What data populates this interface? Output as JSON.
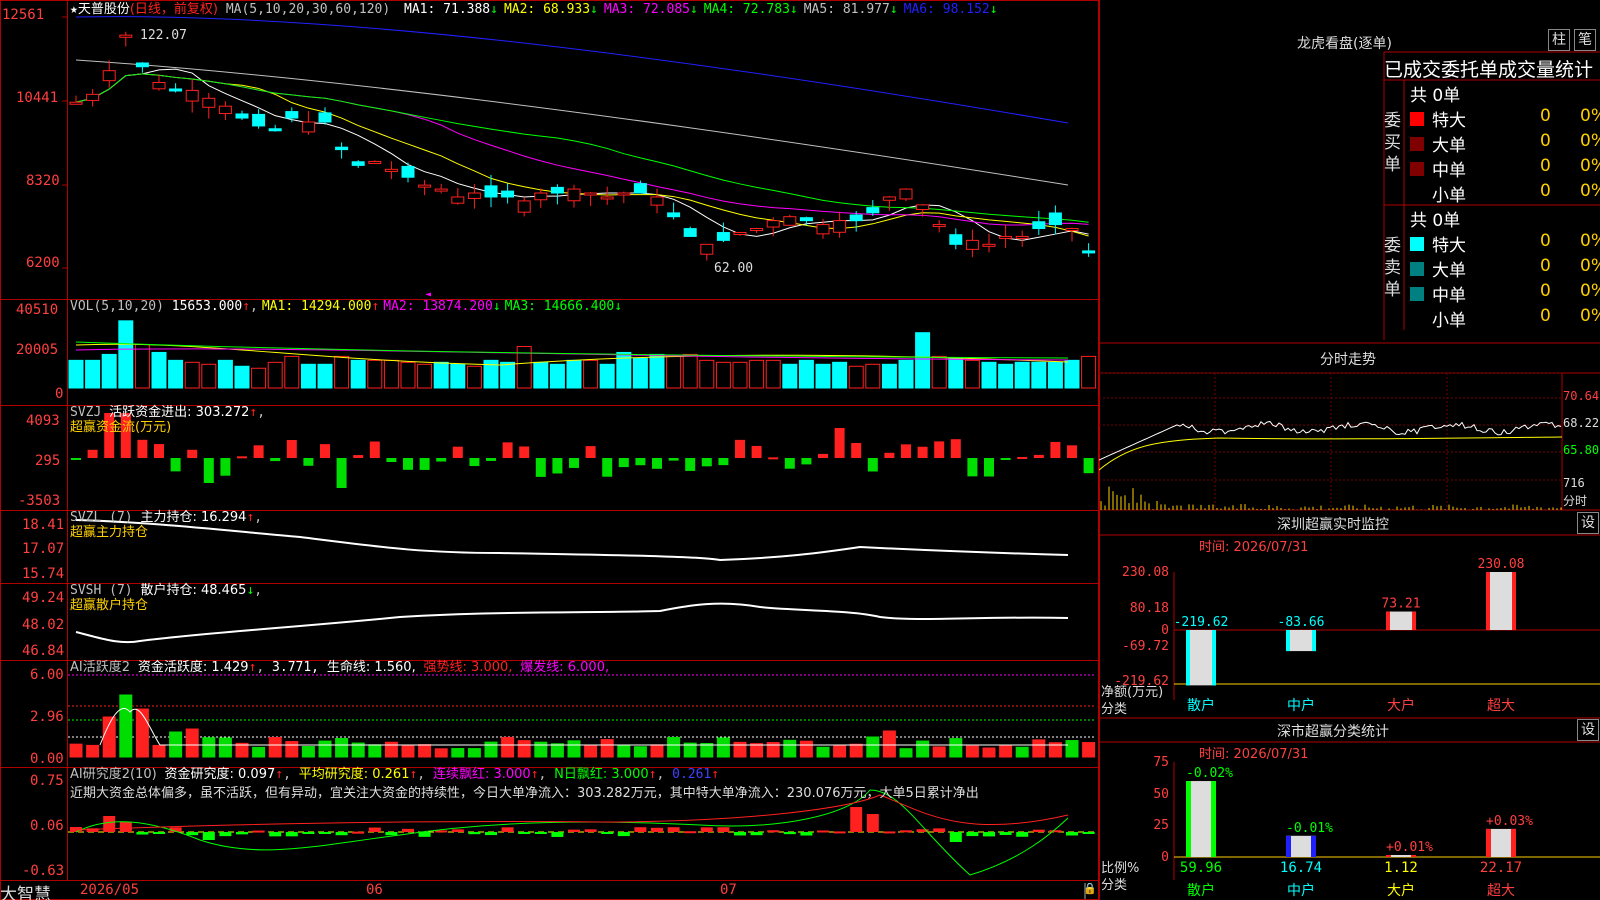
{
  "colors": {
    "up": "#ff2020",
    "down": "#00ffff",
    "ma5": "#ffffff",
    "ma10": "#ffff00",
    "ma20": "#ff00ff",
    "ma30": "#00ff00",
    "ma60": "#c0c0c0",
    "ma120": "#2020ff",
    "grid": "#b00000"
  },
  "main": {
    "stock_name": "天普股份",
    "period": "(日线，前复权)",
    "ma_label": "MA(5,10,20,30,60,120)",
    "ma_values": [
      {
        "label": "MA1: 71.388",
        "arrow": "↓"
      },
      {
        "label": "MA2: 68.933",
        "arrow": "↓"
      },
      {
        "label": "MA3: 72.085",
        "arrow": "↓"
      },
      {
        "label": "MA4: 72.783",
        "arrow": "↓"
      },
      {
        "label": "MA5: 81.977",
        "arrow": "↓"
      },
      {
        "label": "MA6: 98.152",
        "arrow": "↓"
      }
    ],
    "y_labels": [
      "12561",
      "10441",
      "8320",
      "6200"
    ],
    "high_label": "122.07",
    "low_label": "62.00"
  },
  "vol": {
    "title": "VOL(5,10,20)",
    "value": "15653.000",
    "ma": [
      {
        "label": "MA1: 14294.000",
        "arrow": "↑"
      },
      {
        "label": "MA2: 13874.200",
        "arrow": "↓"
      },
      {
        "label": "MA3: 14666.400",
        "arrow": "↓"
      }
    ],
    "y_labels": [
      "40510",
      "20005",
      "0"
    ]
  },
  "svzj": {
    "title": "SVZJ",
    "label": "活跃资金进出: 303.272",
    "arrow": "↑",
    "subtitle": "超赢资金流(万元)",
    "y_labels": [
      "4093",
      "295",
      "-3503"
    ]
  },
  "svzl": {
    "title": "SVZL (7)",
    "label": "主力持仓: 16.294",
    "arrow": "↑",
    "subtitle": "超赢主力持仓",
    "y_labels": [
      "18.41",
      "17.07",
      "15.74"
    ]
  },
  "svsh": {
    "title": "SVSH (7)",
    "label": "散户持仓: 48.465",
    "arrow": "↓",
    "subtitle": "超赢散户持仓",
    "y_labels": [
      "49.24",
      "48.02",
      "46.84"
    ]
  },
  "ai_active": {
    "title": "AI活跃度2",
    "label1": "资金活跃度: 1.429",
    "arrow1": "↑",
    "label2": "3.771,",
    "label3": "生命线: 1.560,",
    "label4": "强势线: 3.000,",
    "label5": "爆发线: 6.000,",
    "y_labels": [
      "6.00",
      "2.96",
      "0.00"
    ]
  },
  "ai_research": {
    "title": "AI研究度2(10)",
    "label1": "资金研究度: 0.097",
    "arrow1": "↑",
    "label2": "平均研究度: 0.261",
    "arrow2": "↑",
    "label3": "连续飘红: 3.000",
    "arrow3": "↑",
    "label4": "N日飘红: 3.000",
    "arrow4": "↑",
    "label5": "0.261",
    "arrow5": "↑",
    "comment": "近期大资金总体偏多，虽不活跃，但有异动，宜关注大资金的持续性，今日大单净流入：303.282万元，其中特大单净流入：230.076万元，大单5日累计净出",
    "y_labels": [
      "0.75",
      "0.06",
      "-0.63"
    ]
  },
  "footer": {
    "brand": "大智慧",
    "dates": [
      "2026/05",
      "06",
      "07"
    ]
  },
  "lhb": {
    "title": "龙虎看盘(逐单)",
    "tab_bar": "柱",
    "tab_pen": "笔",
    "subtitle": "已成交委托单成交量统计",
    "buy_side": "委买单",
    "sell_side": "委卖单",
    "buy": {
      "total": "共 0单",
      "rows": [
        {
          "name": "特大",
          "count": "0",
          "pct": "0%",
          "color": "#ff0000"
        },
        {
          "name": "大单",
          "count": "0",
          "pct": "0%",
          "color": "#800000"
        },
        {
          "name": "中单",
          "count": "0",
          "pct": "0%",
          "color": "#800000"
        },
        {
          "name": "小单",
          "count": "0",
          "pct": "0%",
          "color": ""
        }
      ]
    },
    "sell": {
      "total": "共 0单",
      "rows": [
        {
          "name": "特大",
          "count": "0",
          "pct": "0%",
          "color": "#00ffff"
        },
        {
          "name": "大单",
          "count": "0",
          "pct": "0%",
          "color": "#008080"
        },
        {
          "name": "中单",
          "count": "0",
          "pct": "0%",
          "color": "#008080"
        },
        {
          "name": "小单",
          "count": "0",
          "pct": "0%",
          "color": ""
        }
      ]
    }
  },
  "intraday": {
    "title": "分时走势",
    "y_labels": [
      "70.64",
      "68.22",
      "65.80",
      "716",
      "分时"
    ]
  },
  "sz_monitor": {
    "title": "深圳超赢实时监控",
    "set": "设",
    "time": "时间: 2026/07/31",
    "y_labels": [
      "230.08",
      "80.18",
      "0",
      "-69.72",
      "-219.62"
    ],
    "axis_label": "净额(万元)",
    "axis_label2": "分类",
    "categories": [
      "散户",
      "中户",
      "大户",
      "超大"
    ],
    "values": [
      -219.62,
      -83.66,
      73.21,
      230.08
    ],
    "value_labels": [
      "-219.62",
      "-83.66",
      "73.21",
      "230.08"
    ]
  },
  "sz_class": {
    "title": "深市超赢分类统计",
    "set": "设",
    "time": "时间: 2026/07/31",
    "y_labels": [
      "75",
      "50",
      "25",
      "0"
    ],
    "axis_label": "比例%",
    "axis_label2": "分类",
    "categories": [
      "散户",
      "中户",
      "大户",
      "超大"
    ],
    "values": [
      59.96,
      16.74,
      1.12,
      22.17
    ],
    "value_labels": [
      "59.96",
      "16.74",
      "1.12",
      "22.17"
    ],
    "change_labels": [
      "-0.02%",
      "-0.01%",
      "+0.01%",
      "+0.03%"
    ]
  }
}
